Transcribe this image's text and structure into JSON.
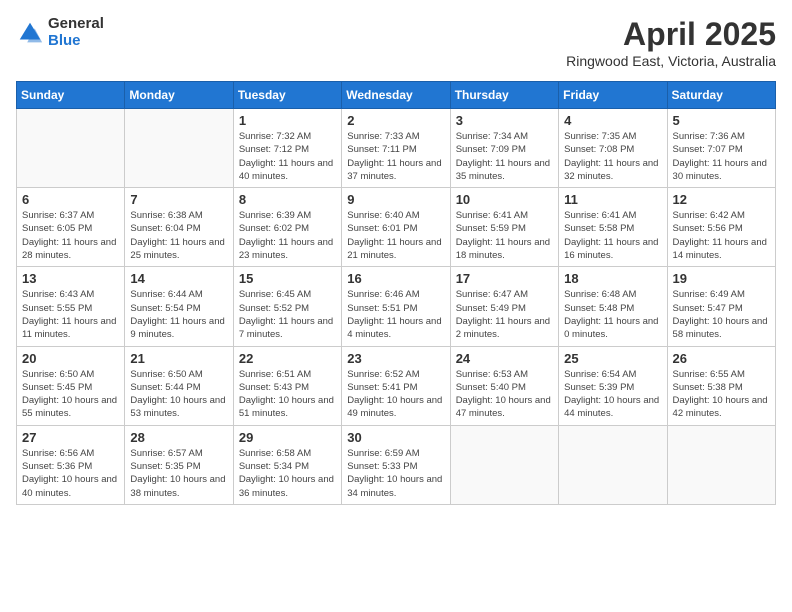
{
  "header": {
    "logo_general": "General",
    "logo_blue": "Blue",
    "month_title": "April 2025",
    "location": "Ringwood East, Victoria, Australia"
  },
  "weekdays": [
    "Sunday",
    "Monday",
    "Tuesday",
    "Wednesday",
    "Thursday",
    "Friday",
    "Saturday"
  ],
  "weeks": [
    [
      {
        "day": "",
        "detail": ""
      },
      {
        "day": "",
        "detail": ""
      },
      {
        "day": "1",
        "detail": "Sunrise: 7:32 AM\nSunset: 7:12 PM\nDaylight: 11 hours and 40 minutes."
      },
      {
        "day": "2",
        "detail": "Sunrise: 7:33 AM\nSunset: 7:11 PM\nDaylight: 11 hours and 37 minutes."
      },
      {
        "day": "3",
        "detail": "Sunrise: 7:34 AM\nSunset: 7:09 PM\nDaylight: 11 hours and 35 minutes."
      },
      {
        "day": "4",
        "detail": "Sunrise: 7:35 AM\nSunset: 7:08 PM\nDaylight: 11 hours and 32 minutes."
      },
      {
        "day": "5",
        "detail": "Sunrise: 7:36 AM\nSunset: 7:07 PM\nDaylight: 11 hours and 30 minutes."
      }
    ],
    [
      {
        "day": "6",
        "detail": "Sunrise: 6:37 AM\nSunset: 6:05 PM\nDaylight: 11 hours and 28 minutes."
      },
      {
        "day": "7",
        "detail": "Sunrise: 6:38 AM\nSunset: 6:04 PM\nDaylight: 11 hours and 25 minutes."
      },
      {
        "day": "8",
        "detail": "Sunrise: 6:39 AM\nSunset: 6:02 PM\nDaylight: 11 hours and 23 minutes."
      },
      {
        "day": "9",
        "detail": "Sunrise: 6:40 AM\nSunset: 6:01 PM\nDaylight: 11 hours and 21 minutes."
      },
      {
        "day": "10",
        "detail": "Sunrise: 6:41 AM\nSunset: 5:59 PM\nDaylight: 11 hours and 18 minutes."
      },
      {
        "day": "11",
        "detail": "Sunrise: 6:41 AM\nSunset: 5:58 PM\nDaylight: 11 hours and 16 minutes."
      },
      {
        "day": "12",
        "detail": "Sunrise: 6:42 AM\nSunset: 5:56 PM\nDaylight: 11 hours and 14 minutes."
      }
    ],
    [
      {
        "day": "13",
        "detail": "Sunrise: 6:43 AM\nSunset: 5:55 PM\nDaylight: 11 hours and 11 minutes."
      },
      {
        "day": "14",
        "detail": "Sunrise: 6:44 AM\nSunset: 5:54 PM\nDaylight: 11 hours and 9 minutes."
      },
      {
        "day": "15",
        "detail": "Sunrise: 6:45 AM\nSunset: 5:52 PM\nDaylight: 11 hours and 7 minutes."
      },
      {
        "day": "16",
        "detail": "Sunrise: 6:46 AM\nSunset: 5:51 PM\nDaylight: 11 hours and 4 minutes."
      },
      {
        "day": "17",
        "detail": "Sunrise: 6:47 AM\nSunset: 5:49 PM\nDaylight: 11 hours and 2 minutes."
      },
      {
        "day": "18",
        "detail": "Sunrise: 6:48 AM\nSunset: 5:48 PM\nDaylight: 11 hours and 0 minutes."
      },
      {
        "day": "19",
        "detail": "Sunrise: 6:49 AM\nSunset: 5:47 PM\nDaylight: 10 hours and 58 minutes."
      }
    ],
    [
      {
        "day": "20",
        "detail": "Sunrise: 6:50 AM\nSunset: 5:45 PM\nDaylight: 10 hours and 55 minutes."
      },
      {
        "day": "21",
        "detail": "Sunrise: 6:50 AM\nSunset: 5:44 PM\nDaylight: 10 hours and 53 minutes."
      },
      {
        "day": "22",
        "detail": "Sunrise: 6:51 AM\nSunset: 5:43 PM\nDaylight: 10 hours and 51 minutes."
      },
      {
        "day": "23",
        "detail": "Sunrise: 6:52 AM\nSunset: 5:41 PM\nDaylight: 10 hours and 49 minutes."
      },
      {
        "day": "24",
        "detail": "Sunrise: 6:53 AM\nSunset: 5:40 PM\nDaylight: 10 hours and 47 minutes."
      },
      {
        "day": "25",
        "detail": "Sunrise: 6:54 AM\nSunset: 5:39 PM\nDaylight: 10 hours and 44 minutes."
      },
      {
        "day": "26",
        "detail": "Sunrise: 6:55 AM\nSunset: 5:38 PM\nDaylight: 10 hours and 42 minutes."
      }
    ],
    [
      {
        "day": "27",
        "detail": "Sunrise: 6:56 AM\nSunset: 5:36 PM\nDaylight: 10 hours and 40 minutes."
      },
      {
        "day": "28",
        "detail": "Sunrise: 6:57 AM\nSunset: 5:35 PM\nDaylight: 10 hours and 38 minutes."
      },
      {
        "day": "29",
        "detail": "Sunrise: 6:58 AM\nSunset: 5:34 PM\nDaylight: 10 hours and 36 minutes."
      },
      {
        "day": "30",
        "detail": "Sunrise: 6:59 AM\nSunset: 5:33 PM\nDaylight: 10 hours and 34 minutes."
      },
      {
        "day": "",
        "detail": ""
      },
      {
        "day": "",
        "detail": ""
      },
      {
        "day": "",
        "detail": ""
      }
    ]
  ]
}
